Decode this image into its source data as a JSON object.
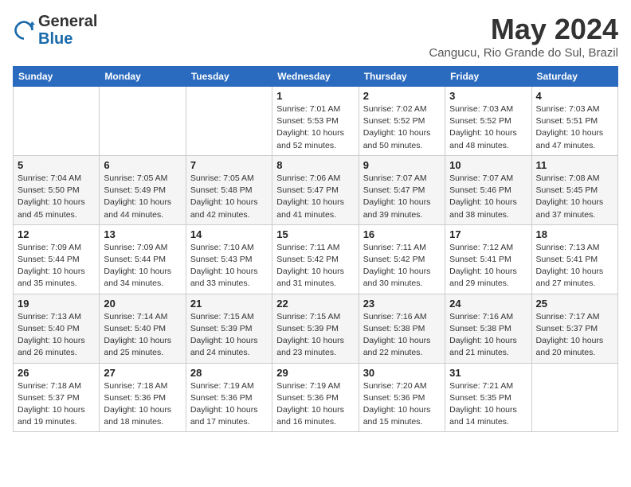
{
  "header": {
    "logo_general": "General",
    "logo_blue": "Blue",
    "month": "May 2024",
    "location": "Cangucu, Rio Grande do Sul, Brazil"
  },
  "weekdays": [
    "Sunday",
    "Monday",
    "Tuesday",
    "Wednesday",
    "Thursday",
    "Friday",
    "Saturday"
  ],
  "weeks": [
    [
      {
        "day": "",
        "info": ""
      },
      {
        "day": "",
        "info": ""
      },
      {
        "day": "",
        "info": ""
      },
      {
        "day": "1",
        "info": "Sunrise: 7:01 AM\nSunset: 5:53 PM\nDaylight: 10 hours\nand 52 minutes."
      },
      {
        "day": "2",
        "info": "Sunrise: 7:02 AM\nSunset: 5:52 PM\nDaylight: 10 hours\nand 50 minutes."
      },
      {
        "day": "3",
        "info": "Sunrise: 7:03 AM\nSunset: 5:52 PM\nDaylight: 10 hours\nand 48 minutes."
      },
      {
        "day": "4",
        "info": "Sunrise: 7:03 AM\nSunset: 5:51 PM\nDaylight: 10 hours\nand 47 minutes."
      }
    ],
    [
      {
        "day": "5",
        "info": "Sunrise: 7:04 AM\nSunset: 5:50 PM\nDaylight: 10 hours\nand 45 minutes."
      },
      {
        "day": "6",
        "info": "Sunrise: 7:05 AM\nSunset: 5:49 PM\nDaylight: 10 hours\nand 44 minutes."
      },
      {
        "day": "7",
        "info": "Sunrise: 7:05 AM\nSunset: 5:48 PM\nDaylight: 10 hours\nand 42 minutes."
      },
      {
        "day": "8",
        "info": "Sunrise: 7:06 AM\nSunset: 5:47 PM\nDaylight: 10 hours\nand 41 minutes."
      },
      {
        "day": "9",
        "info": "Sunrise: 7:07 AM\nSunset: 5:47 PM\nDaylight: 10 hours\nand 39 minutes."
      },
      {
        "day": "10",
        "info": "Sunrise: 7:07 AM\nSunset: 5:46 PM\nDaylight: 10 hours\nand 38 minutes."
      },
      {
        "day": "11",
        "info": "Sunrise: 7:08 AM\nSunset: 5:45 PM\nDaylight: 10 hours\nand 37 minutes."
      }
    ],
    [
      {
        "day": "12",
        "info": "Sunrise: 7:09 AM\nSunset: 5:44 PM\nDaylight: 10 hours\nand 35 minutes."
      },
      {
        "day": "13",
        "info": "Sunrise: 7:09 AM\nSunset: 5:44 PM\nDaylight: 10 hours\nand 34 minutes."
      },
      {
        "day": "14",
        "info": "Sunrise: 7:10 AM\nSunset: 5:43 PM\nDaylight: 10 hours\nand 33 minutes."
      },
      {
        "day": "15",
        "info": "Sunrise: 7:11 AM\nSunset: 5:42 PM\nDaylight: 10 hours\nand 31 minutes."
      },
      {
        "day": "16",
        "info": "Sunrise: 7:11 AM\nSunset: 5:42 PM\nDaylight: 10 hours\nand 30 minutes."
      },
      {
        "day": "17",
        "info": "Sunrise: 7:12 AM\nSunset: 5:41 PM\nDaylight: 10 hours\nand 29 minutes."
      },
      {
        "day": "18",
        "info": "Sunrise: 7:13 AM\nSunset: 5:41 PM\nDaylight: 10 hours\nand 27 minutes."
      }
    ],
    [
      {
        "day": "19",
        "info": "Sunrise: 7:13 AM\nSunset: 5:40 PM\nDaylight: 10 hours\nand 26 minutes."
      },
      {
        "day": "20",
        "info": "Sunrise: 7:14 AM\nSunset: 5:40 PM\nDaylight: 10 hours\nand 25 minutes."
      },
      {
        "day": "21",
        "info": "Sunrise: 7:15 AM\nSunset: 5:39 PM\nDaylight: 10 hours\nand 24 minutes."
      },
      {
        "day": "22",
        "info": "Sunrise: 7:15 AM\nSunset: 5:39 PM\nDaylight: 10 hours\nand 23 minutes."
      },
      {
        "day": "23",
        "info": "Sunrise: 7:16 AM\nSunset: 5:38 PM\nDaylight: 10 hours\nand 22 minutes."
      },
      {
        "day": "24",
        "info": "Sunrise: 7:16 AM\nSunset: 5:38 PM\nDaylight: 10 hours\nand 21 minutes."
      },
      {
        "day": "25",
        "info": "Sunrise: 7:17 AM\nSunset: 5:37 PM\nDaylight: 10 hours\nand 20 minutes."
      }
    ],
    [
      {
        "day": "26",
        "info": "Sunrise: 7:18 AM\nSunset: 5:37 PM\nDaylight: 10 hours\nand 19 minutes."
      },
      {
        "day": "27",
        "info": "Sunrise: 7:18 AM\nSunset: 5:36 PM\nDaylight: 10 hours\nand 18 minutes."
      },
      {
        "day": "28",
        "info": "Sunrise: 7:19 AM\nSunset: 5:36 PM\nDaylight: 10 hours\nand 17 minutes."
      },
      {
        "day": "29",
        "info": "Sunrise: 7:19 AM\nSunset: 5:36 PM\nDaylight: 10 hours\nand 16 minutes."
      },
      {
        "day": "30",
        "info": "Sunrise: 7:20 AM\nSunset: 5:36 PM\nDaylight: 10 hours\nand 15 minutes."
      },
      {
        "day": "31",
        "info": "Sunrise: 7:21 AM\nSunset: 5:35 PM\nDaylight: 10 hours\nand 14 minutes."
      },
      {
        "day": "",
        "info": ""
      }
    ]
  ]
}
